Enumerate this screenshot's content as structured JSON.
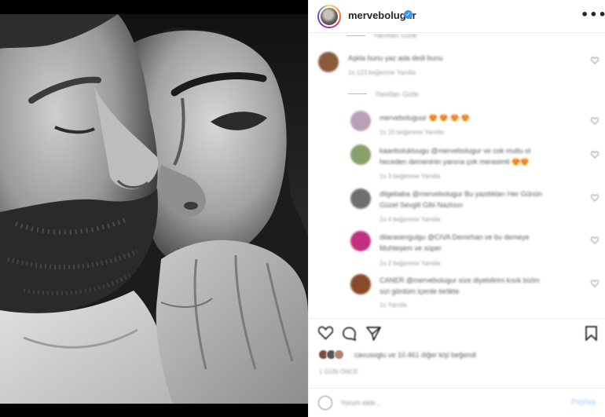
{
  "post": {
    "username": "mervebolugur",
    "more_label": "•••",
    "verified_mark": "✓"
  },
  "comments": {
    "view_replies": "Yanıtları Gizle",
    "items": [
      {
        "text": "Aşkla bunu yaz ada dedi bunu",
        "meta": "1s   123 beğenme   Yanıtla",
        "avatar_color": "#8a5a3c",
        "indent": false
      },
      {
        "text": "Yanıtları Gizle",
        "meta": "",
        "avatar_color": "",
        "indent": true,
        "is_link": true
      },
      {
        "text": "merveboluguur 😍 😍 😍 😍",
        "meta": "1s   10 beğenme   Yanıtla",
        "avatar_color": "#b9a0b8",
        "indent": true
      },
      {
        "text": "kaanbolukluugu @mervebolugur ve cok mutlu ol",
        "text2": "heceden demeninin yanına çok merasimli 😍😍",
        "meta": "1s   3 beğenme   Yanıtla",
        "avatar_color": "#8aa06b",
        "indent": true
      },
      {
        "text": "dilgebaba @mervebolugur Bu yazdıkları Her Günün",
        "text2": "Güzel Sevgili Gibi Nazlısın",
        "meta": "1s   4 beğenme   Yanıtla",
        "avatar_color": "#6f6f6f",
        "indent": true
      },
      {
        "text": "dilarasengulgu @CIVA Demirhan ve bu demeye",
        "text2": "Muhteşem ve süper",
        "meta": "1s   2 beğenme   Yanıtla",
        "avatar_color": "#c0307f",
        "indent": true
      },
      {
        "text": "CANER @mervebolugur size diyebilirim kısık bizim",
        "text2": "sizi gördüm içerde birlikte",
        "meta": "1s   Yanıtla",
        "avatar_color": "#8a4a2a",
        "indent": true
      }
    ]
  },
  "actions": {
    "like_icon": "heart-icon",
    "comment_icon": "comment-icon",
    "share_icon": "share-icon",
    "save_icon": "bookmark-icon"
  },
  "likes": {
    "text": "cavusoglu ve 10.461 diğer kişi beğendi"
  },
  "date": "1 GÜN ÖNCE",
  "add_comment": {
    "placeholder": "Yorum ekle...",
    "post_label": "Paylaş"
  }
}
